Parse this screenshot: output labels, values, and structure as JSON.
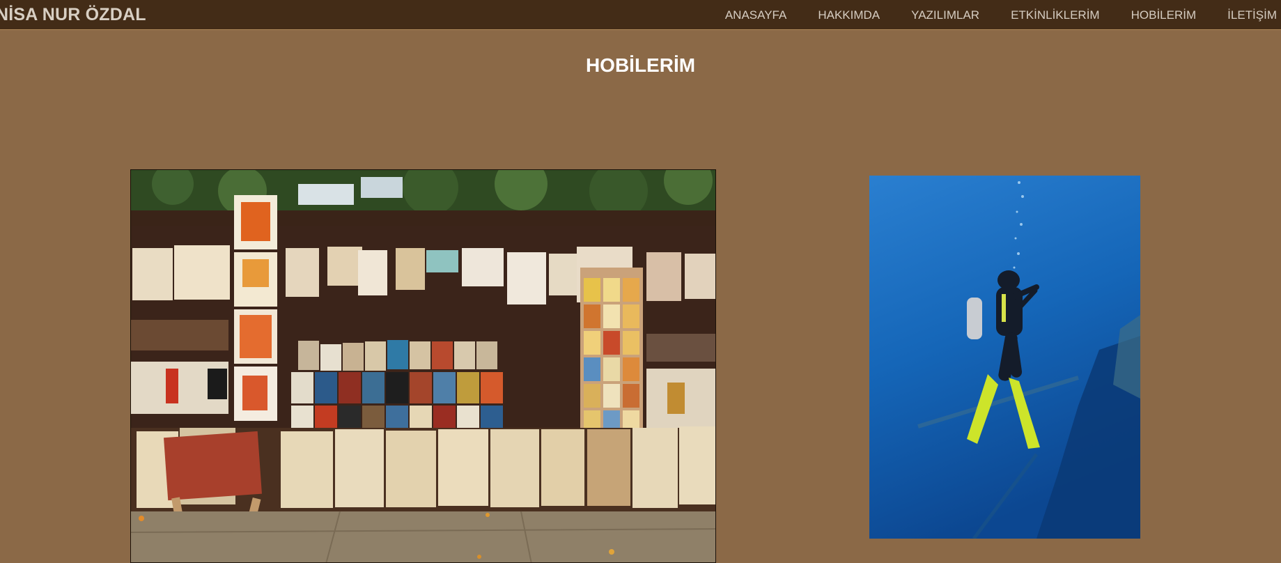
{
  "header": {
    "brand": "NİSA NUR ÖZDAL",
    "nav": [
      {
        "label": "ANASAYFA"
      },
      {
        "label": "HAKKIMDA"
      },
      {
        "label": "YAZILIMLAR"
      },
      {
        "label": "ETKİNLİKLERİM"
      },
      {
        "label": "HOBİLERİM"
      },
      {
        "label": "İLETİŞİM"
      }
    ]
  },
  "main": {
    "title": "HOBİLERİM"
  },
  "colors": {
    "background": "#8b6947",
    "topbar": "#432c17",
    "nav_text": "#d6cdc2",
    "title_text": "#ffffff"
  }
}
